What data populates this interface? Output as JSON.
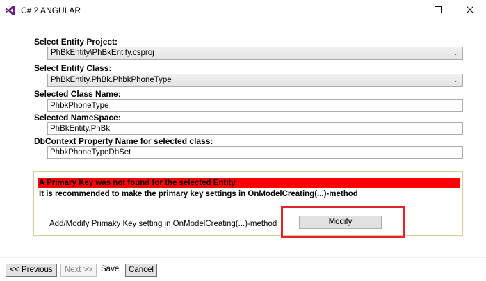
{
  "window": {
    "title": "C# 2 ANGULAR",
    "icon": "visual-studio-icon",
    "controls": [
      "minimize-icon",
      "maximize-icon",
      "close-icon"
    ]
  },
  "form": {
    "entity_project_label": "Select Entity Project:",
    "entity_project_value": "PhBkEntity\\PhBkEntity.csproj",
    "entity_class_label": "Select Entity Class:",
    "entity_class_value": "PhBkEntity.PhBk.PhbkPhoneType",
    "class_name_label": "Selected Class Name:",
    "class_name_value": "PhbkPhoneType",
    "namespace_label": "Selected NameSpace:",
    "namespace_value": "PhBkEntity.PhBk",
    "dbcontext_label": "DbContext Property Name for selected class:",
    "dbcontext_value": "PhbkPhoneTypeDbSet"
  },
  "primary_key": {
    "error_text": "A Primary Key was not found for the selected Entity",
    "recommendation_text": "It is recommended to make the primary key settings in OnModelCreating(...)-method",
    "action_label": "Add/Modify Primaky Key setting in OnModelCreating(...)-method",
    "modify_button": "Modify",
    "error_color": "#ff0000",
    "highlight_color": "#e0242c"
  },
  "footer": {
    "previous_button": "<< Previous",
    "next_button": "Next >>",
    "save_label": "Save",
    "cancel_button": "Cancel"
  }
}
